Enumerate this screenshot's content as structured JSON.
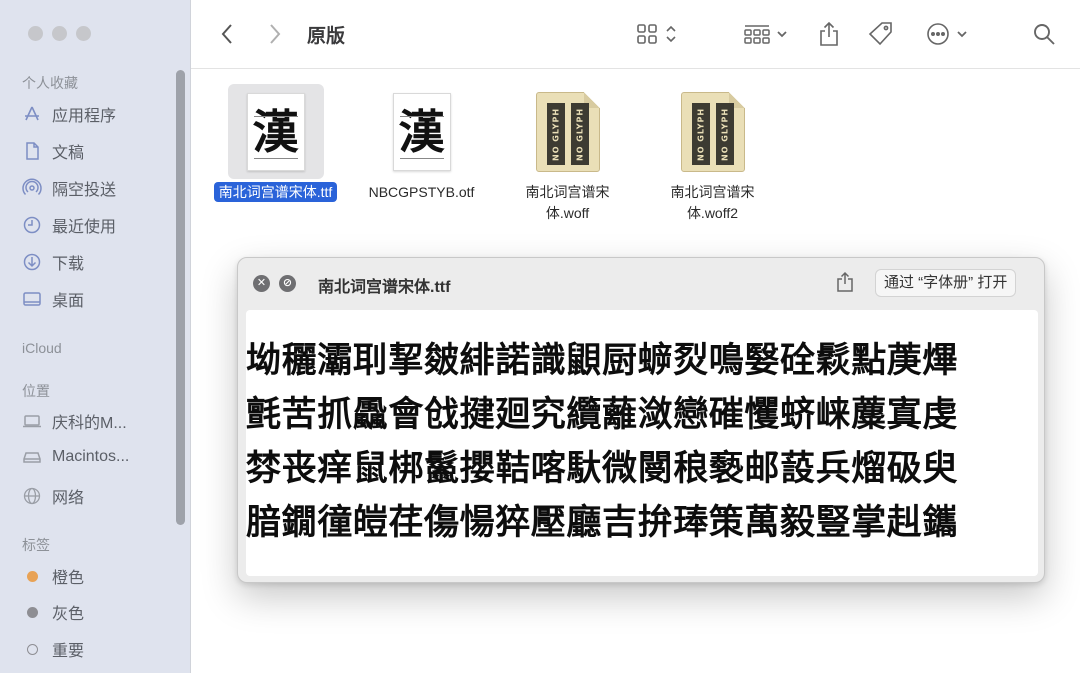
{
  "sidebar": {
    "favorites_title": "个人收藏",
    "favorites": [
      {
        "label": "应用程序",
        "icon": "applications-icon"
      },
      {
        "label": "文稿",
        "icon": "document-icon"
      },
      {
        "label": "隔空投送",
        "icon": "airdrop-icon"
      },
      {
        "label": "最近使用",
        "icon": "clock-icon"
      },
      {
        "label": "下载",
        "icon": "download-icon"
      },
      {
        "label": "桌面",
        "icon": "desktop-icon"
      }
    ],
    "icloud_title": "iCloud",
    "locations_title": "位置",
    "locations": [
      {
        "label": "庆科的M...",
        "icon": "laptop-icon"
      },
      {
        "label": "Macintos...",
        "icon": "drive-icon"
      },
      {
        "label": "网络",
        "icon": "globe-icon"
      }
    ],
    "tags_title": "标签",
    "tags": [
      {
        "label": "橙色",
        "color": "#e8a255"
      },
      {
        "label": "灰色",
        "color": "#8e8e93"
      },
      {
        "label": "重要",
        "color": "#ffffff"
      }
    ]
  },
  "toolbar": {
    "folder_title": "原版"
  },
  "files": [
    {
      "name": "南北词宫谱宋体.ttf",
      "preview": "漢",
      "selected": true
    },
    {
      "name": "NBCGPSTYB.otf",
      "preview": "漢",
      "selected": false
    },
    {
      "name": "南北词宫谱宋体.woff",
      "preview": "NO GLYPH",
      "selected": false
    },
    {
      "name": "南北词宫谱宋体.woff2",
      "preview": "NO GLYPH",
      "selected": false
    }
  ],
  "quicklook": {
    "title": "南北词宫谱宋体.ttf",
    "open_button": "通过 “字体册” 打开",
    "sample_lines": [
      "坳穲灞刵挈皴緋諾識鼰厨蝷烮鳴嫛硂鬏點菮熚",
      "氈苦抓飍會戗揵廻究纜蘺潋戀磪戄蛴崃蘪寘虔",
      "棼丧痒鼠梆鬣攖鞊喀馱微閿稂褻邮蔎兵熘砐臾",
      "腤鐗徸皚荏傷愓猝壓廳吉拚琫策萬毅豎掌赳鑴"
    ]
  }
}
